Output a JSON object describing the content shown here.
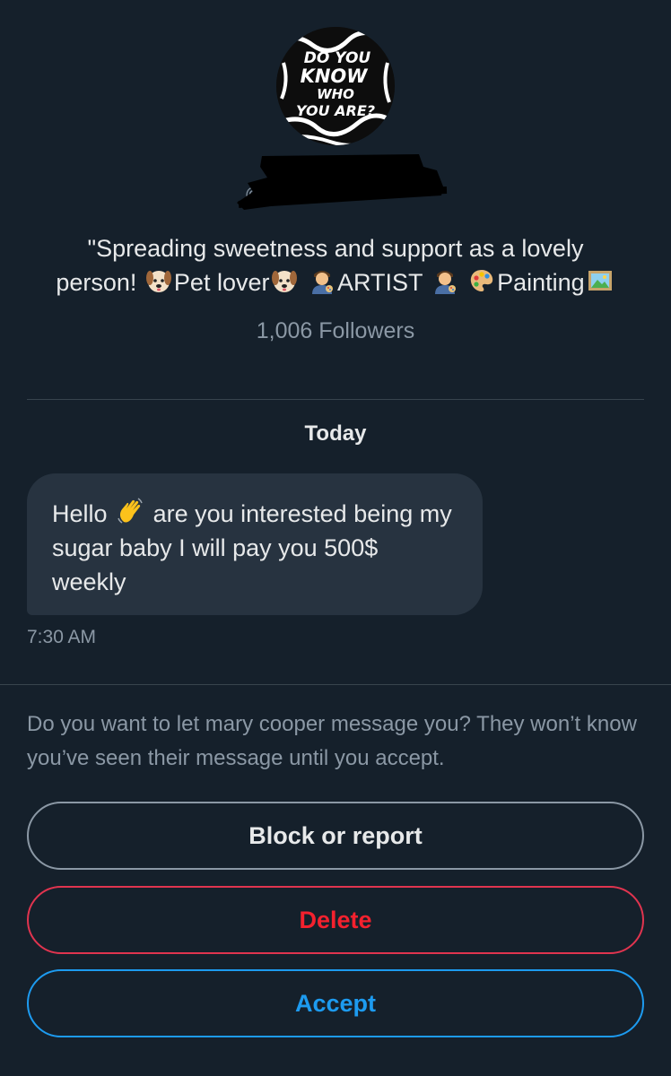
{
  "profile": {
    "avatar_text": [
      "DO YOU",
      "KNOW",
      "WHO",
      "YOU ARE?"
    ],
    "handle_fragment": "@",
    "bio": {
      "part1": "\"Spreading sweetness and support as a lovely",
      "part2": "person!",
      "part3": "Pet lover",
      "part4": "ARTIST",
      "part5": "Painting"
    },
    "followers": "1,006 Followers"
  },
  "conversation": {
    "date_separator": "Today",
    "message": {
      "before_emoji": "Hello",
      "after_emoji": "are you interested being my sugar baby I will pay you 500$ weekly",
      "time": "7:30 AM"
    }
  },
  "request": {
    "prompt": "Do you want to let mary cooper message you? They won’t know you’ve seen their message until you accept.",
    "block_label": "Block or report",
    "delete_label": "Delete",
    "accept_label": "Accept"
  },
  "icons": {
    "dog": "dog-face-icon",
    "artist": "artist-icon",
    "palette": "palette-icon",
    "picture": "framed-picture-icon",
    "wave": "waving-hand-icon"
  },
  "colors": {
    "background": "#15202b",
    "bubble": "#273340",
    "muted_text": "#8b98a5",
    "danger": "#f4212e",
    "accent": "#1d9bf0"
  }
}
